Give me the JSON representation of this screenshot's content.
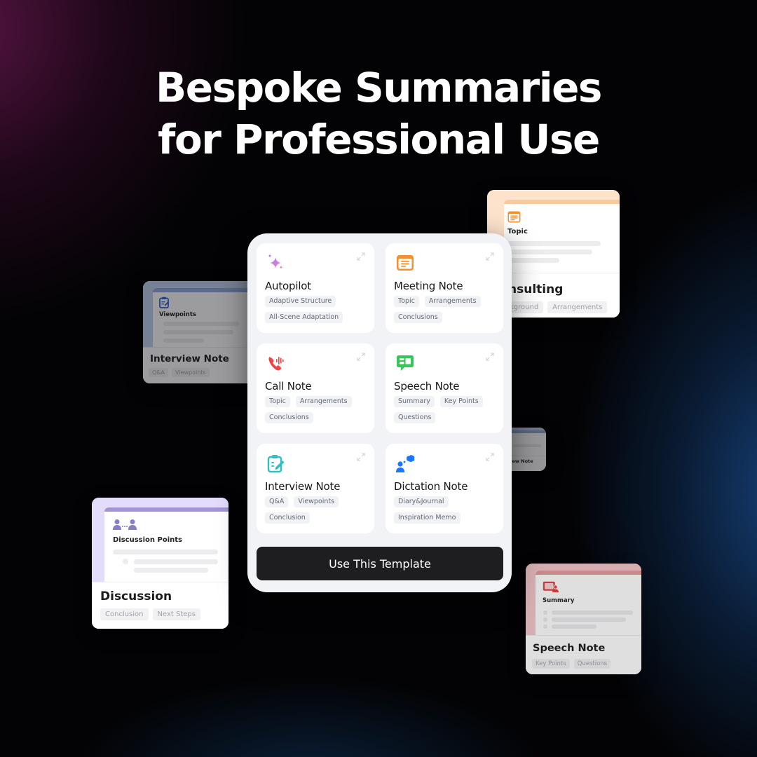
{
  "headline": {
    "line1": "Bespoke Summaries",
    "line2": "for Professional Use"
  },
  "colors": {
    "autopilot": "#c77ae8",
    "meeting": "#f5902f",
    "call": "#ef4444",
    "speech": "#34c759",
    "interview": "#2cc1c0",
    "dictation": "#1677ff",
    "button_bg": "#1e1e20"
  },
  "templates": [
    {
      "title": "Autopilot",
      "icon": "sparkles-icon",
      "tags": [
        "Adaptive Structure",
        "All-Scene Adaptation"
      ]
    },
    {
      "title": "Meeting Note",
      "icon": "document-list-icon",
      "tags": [
        "Topic",
        "Arrangements",
        "Conclusions"
      ]
    },
    {
      "title": "Call Note",
      "icon": "phone-waveform-icon",
      "tags": [
        "Topic",
        "Arrangements",
        "Conclusions"
      ]
    },
    {
      "title": "Speech Note",
      "icon": "speech-bubble-icon",
      "tags": [
        "Summary",
        "Key Points",
        "Questions"
      ]
    },
    {
      "title": "Interview Note",
      "icon": "clipboard-edit-icon",
      "tags": [
        "Q&A",
        "Viewpoints",
        "Conclusion"
      ]
    },
    {
      "title": "Dictation Note",
      "icon": "person-thought-icon",
      "tags": [
        "Diary&Journal",
        "Inspiration Memo"
      ]
    }
  ],
  "use_button": "Use This Template",
  "floating_cards": {
    "consulting": {
      "section": "Topic",
      "title": "nsulting",
      "tags": [
        "kground",
        "Arrangements"
      ]
    },
    "interview": {
      "section": "Viewpoints",
      "title": "Interview Note",
      "tags": [
        "Q&A",
        "Viewpoints"
      ]
    },
    "small": {
      "title": "view Note"
    },
    "discussion": {
      "section": "Discussion Points",
      "title": "Discussion",
      "tags": [
        "Conclusion",
        "Next Steps"
      ]
    },
    "speech": {
      "section": "Summary",
      "title": "Speech Note",
      "tags": [
        "Key Points",
        "Questions"
      ]
    }
  }
}
